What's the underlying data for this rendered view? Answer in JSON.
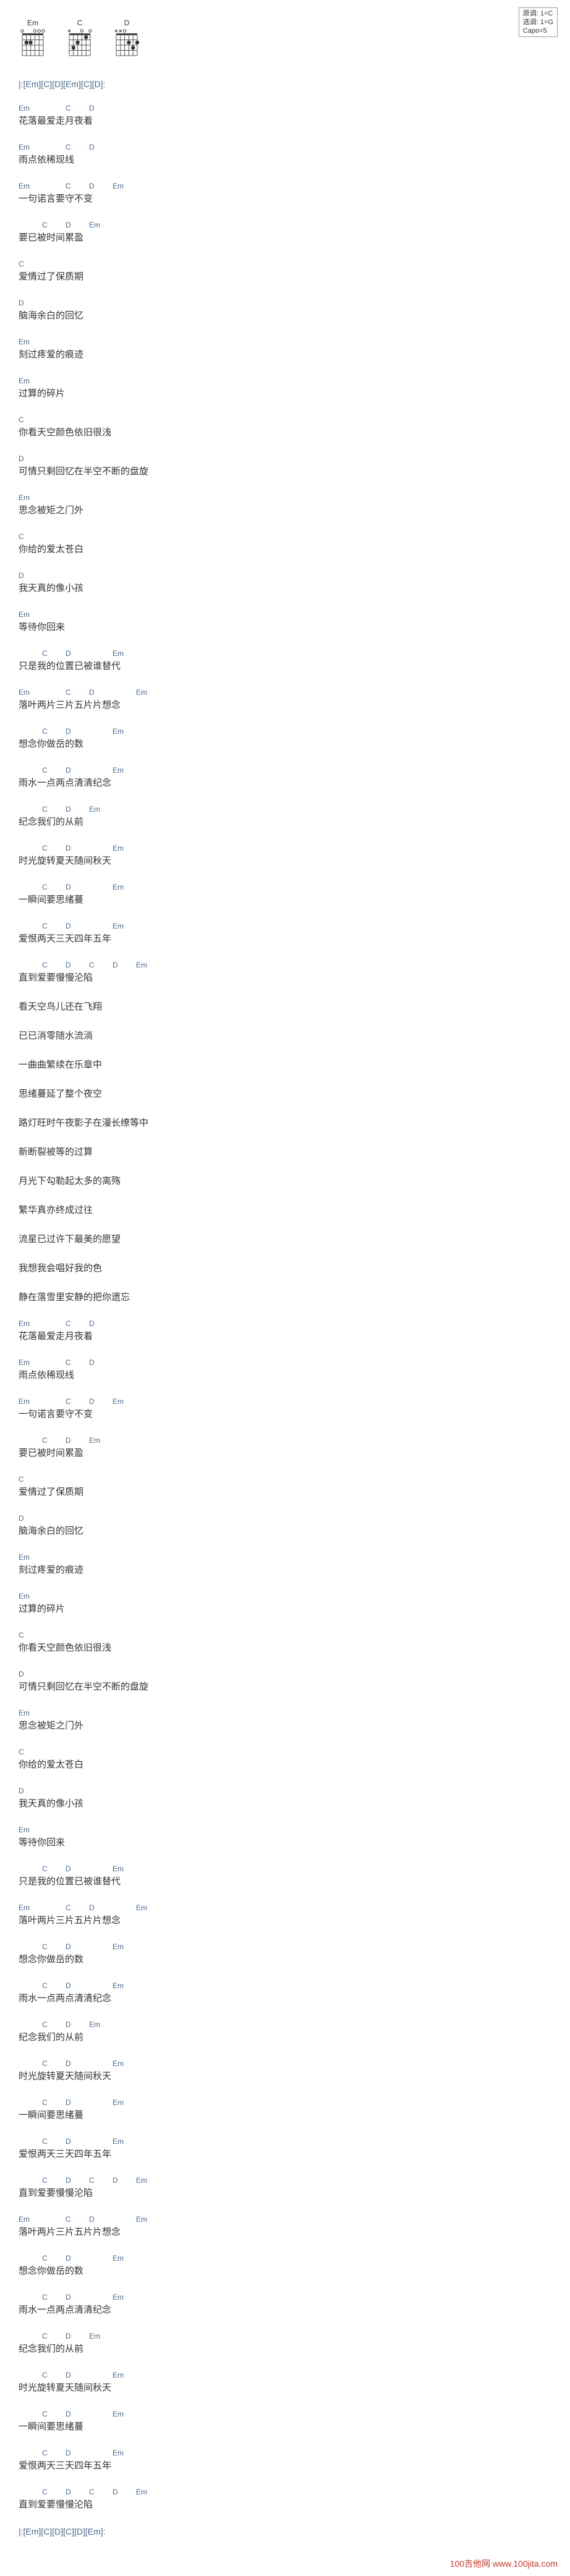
{
  "info": {
    "line1": "原调: 1=C",
    "line2": "选调: 1=G",
    "line3": "Capo=5"
  },
  "chord_diagrams": [
    {
      "name": "Em"
    },
    {
      "name": "C"
    },
    {
      "name": "D"
    }
  ],
  "intro": "|:[Em][C][D][Em][C][D]:",
  "lines": [
    {
      "chords": [
        "Em",
        "",
        "C",
        "D"
      ],
      "lyric": "花落最爱走月夜着"
    },
    {
      "chords": [
        "Em",
        "",
        "C",
        "D"
      ],
      "lyric": "雨点依稀现线"
    },
    {
      "chords": [
        "Em",
        "",
        "C",
        "D",
        "Em"
      ],
      "lyric": "一句诺言要守不变"
    },
    {
      "chords": [
        "",
        "C",
        "D",
        "Em"
      ],
      "lyric": "要已被时间累盈"
    },
    {
      "chords": [
        "C"
      ],
      "lyric": "爱情过了保质期"
    },
    {
      "chords": [
        "D"
      ],
      "lyric": "脑海余白的回忆"
    },
    {
      "chords": [
        "Em"
      ],
      "lyric": "刻过疼爱的痕迹"
    },
    {
      "chords": [
        "Em"
      ],
      "lyric": "过算的碎片"
    },
    {
      "chords": [
        "C"
      ],
      "lyric": "你看天空颜色依旧很浅"
    },
    {
      "chords": [
        "D"
      ],
      "lyric": "可情只剩回忆在半空不断的盘旋"
    },
    {
      "chords": [
        "Em"
      ],
      "lyric": "思念被矩之门外"
    },
    {
      "chords": [
        "C"
      ],
      "lyric": "你给的爱太苍白"
    },
    {
      "chords": [
        "D"
      ],
      "lyric": "我天真的像小孩"
    },
    {
      "chords": [
        "Em"
      ],
      "lyric": "等待你回来"
    },
    {
      "chords": [
        "",
        "C",
        "D",
        "",
        "Em"
      ],
      "lyric": "只是我的位置已被谁替代"
    },
    {
      "chords": [
        "Em",
        "",
        "C",
        "D",
        "",
        "Em"
      ],
      "lyric": "落叶两片三片五片片想念"
    },
    {
      "chords": [
        "",
        "C",
        "D",
        "",
        "Em"
      ],
      "lyric": "想念你做岳的数"
    },
    {
      "chords": [
        "",
        "C",
        "D",
        "",
        "Em"
      ],
      "lyric": "雨水一点两点清清纪念"
    },
    {
      "chords": [
        "",
        "C",
        "D",
        "Em"
      ],
      "lyric": "纪念我们的从前"
    },
    {
      "chords": [
        "",
        "C",
        "D",
        "",
        "Em"
      ],
      "lyric": "时光旋转夏天随间秋天"
    },
    {
      "chords": [
        "",
        "C",
        "D",
        "",
        "Em"
      ],
      "lyric": "一瞬间要思绪蔓"
    },
    {
      "chords": [
        "",
        "C",
        "D",
        "",
        "Em"
      ],
      "lyric": "爱恨两天三天四年五年"
    },
    {
      "chords": [
        "",
        "C",
        "D",
        "C",
        "D",
        "Em"
      ],
      "lyric": "直到爱要慢慢沦陷"
    },
    {
      "chords": [],
      "lyric": "看天空鸟儿还在飞翔"
    },
    {
      "chords": [],
      "lyric": "已已消零随水流淌"
    },
    {
      "chords": [],
      "lyric": "一曲曲繁续在乐章中"
    },
    {
      "chords": [],
      "lyric": "思绪蔓延了整个夜空"
    },
    {
      "chords": [],
      "lyric": "路灯旺时午夜影子在漫长缭等中"
    },
    {
      "chords": [],
      "lyric": "新断裂被等的过算"
    },
    {
      "chords": [],
      "lyric": "月光下勾勒起太多的离殇"
    },
    {
      "chords": [],
      "lyric": "繁华真亦终成过往"
    },
    {
      "chords": [],
      "lyric": "流星已过许下最美的愿望"
    },
    {
      "chords": [],
      "lyric": "我想我会唱好我的色"
    },
    {
      "chords": [],
      "lyric": "静在落雪里安静的把你遗忘"
    },
    {
      "chords": [
        "Em",
        "",
        "C",
        "D"
      ],
      "lyric": "花落最爱走月夜着"
    },
    {
      "chords": [
        "Em",
        "",
        "C",
        "D"
      ],
      "lyric": "雨点依稀现线"
    },
    {
      "chords": [
        "Em",
        "",
        "C",
        "D",
        "Em"
      ],
      "lyric": "一句诺言要守不变"
    },
    {
      "chords": [
        "",
        "C",
        "D",
        "Em"
      ],
      "lyric": "要已被时间累盈"
    },
    {
      "chords": [
        "C"
      ],
      "lyric": "爱情过了保质期"
    },
    {
      "chords": [
        "D"
      ],
      "lyric": "脑海余白的回忆"
    },
    {
      "chords": [
        "Em"
      ],
      "lyric": "刻过疼爱的痕迹"
    },
    {
      "chords": [
        "Em"
      ],
      "lyric": "过算的碎片"
    },
    {
      "chords": [
        "C"
      ],
      "lyric": "你看天空颜色依旧很浅"
    },
    {
      "chords": [
        "D"
      ],
      "lyric": "可情只剩回忆在半空不断的盘旋"
    },
    {
      "chords": [
        "Em"
      ],
      "lyric": "思念被矩之门外"
    },
    {
      "chords": [
        "C"
      ],
      "lyric": "你给的爱太苍白"
    },
    {
      "chords": [
        "D"
      ],
      "lyric": "我天真的像小孩"
    },
    {
      "chords": [
        "Em"
      ],
      "lyric": "等待你回来"
    },
    {
      "chords": [
        "",
        "C",
        "D",
        "",
        "Em"
      ],
      "lyric": "只是我的位置已被谁替代"
    },
    {
      "chords": [
        "Em",
        "",
        "C",
        "D",
        "",
        "Em"
      ],
      "lyric": "落叶两片三片五片片想念"
    },
    {
      "chords": [
        "",
        "C",
        "D",
        "",
        "Em"
      ],
      "lyric": "想念你做岳的数"
    },
    {
      "chords": [
        "",
        "C",
        "D",
        "",
        "Em"
      ],
      "lyric": "雨水一点两点清清纪念"
    },
    {
      "chords": [
        "",
        "C",
        "D",
        "Em"
      ],
      "lyric": "纪念我们的从前"
    },
    {
      "chords": [
        "",
        "C",
        "D",
        "",
        "Em"
      ],
      "lyric": "时光旋转夏天随间秋天"
    },
    {
      "chords": [
        "",
        "C",
        "D",
        "",
        "Em"
      ],
      "lyric": "一瞬间要思绪蔓"
    },
    {
      "chords": [
        "",
        "C",
        "D",
        "",
        "Em"
      ],
      "lyric": "爱恨两天三天四年五年"
    },
    {
      "chords": [
        "",
        "C",
        "D",
        "C",
        "D",
        "Em"
      ],
      "lyric": "直到爱要慢慢沦陷"
    },
    {
      "chords": [
        "Em",
        "",
        "C",
        "D",
        "",
        "Em"
      ],
      "lyric": "落叶两片三片五片片想念"
    },
    {
      "chords": [
        "",
        "C",
        "D",
        "",
        "Em"
      ],
      "lyric": "想念你做岳的数"
    },
    {
      "chords": [
        "",
        "C",
        "D",
        "",
        "Em"
      ],
      "lyric": "雨水一点两点清清纪念"
    },
    {
      "chords": [
        "",
        "C",
        "D",
        "Em"
      ],
      "lyric": "纪念我们的从前"
    },
    {
      "chords": [
        "",
        "C",
        "D",
        "",
        "Em"
      ],
      "lyric": "时光旋转夏天随间秋天"
    },
    {
      "chords": [
        "",
        "C",
        "D",
        "",
        "Em"
      ],
      "lyric": "一瞬间要思绪蔓"
    },
    {
      "chords": [
        "",
        "C",
        "D",
        "",
        "Em"
      ],
      "lyric": "爱恨两天三天四年五年"
    },
    {
      "chords": [
        "",
        "C",
        "D",
        "C",
        "D",
        "Em"
      ],
      "lyric": "直到爱要慢慢沦陷"
    }
  ],
  "outro": "|:[Em][C][D][C][D][Em]:",
  "watermark": "100吉他网 www.100jita.com"
}
